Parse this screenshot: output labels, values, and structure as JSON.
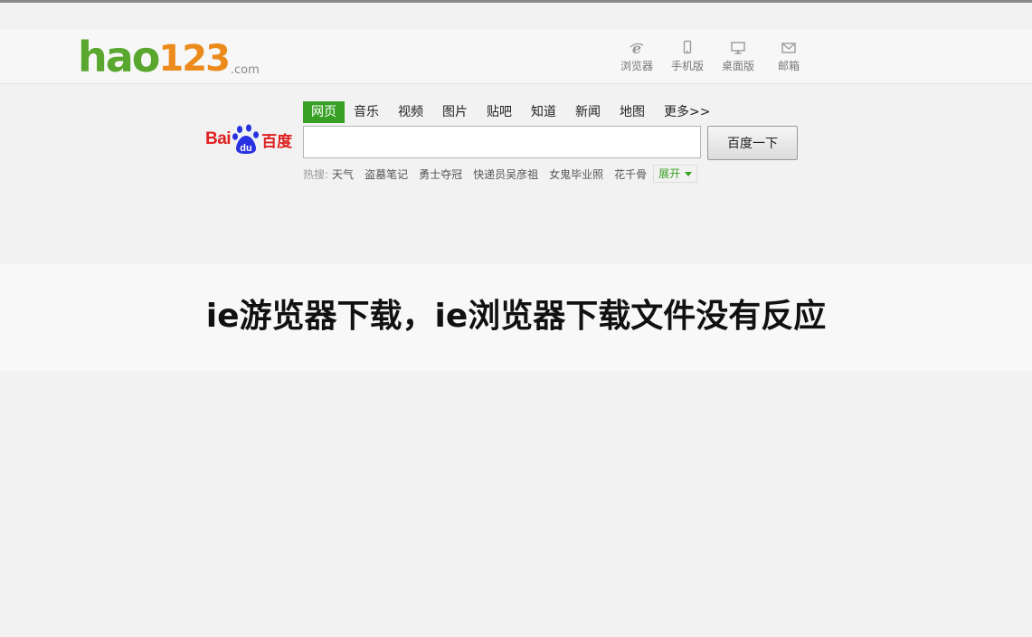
{
  "header": {
    "logo": {
      "main": "hao",
      "num": "123",
      "suffix": ".com"
    },
    "tools": [
      {
        "label": "浏览器",
        "icon": "ie-icon"
      },
      {
        "label": "手机版",
        "icon": "phone-icon"
      },
      {
        "label": "桌面版",
        "icon": "desktop-icon"
      },
      {
        "label": "邮箱",
        "icon": "mail-icon"
      }
    ]
  },
  "search": {
    "logo": {
      "bai": "Bai",
      "paw": "du",
      "cn": "百度"
    },
    "tabs": [
      "网页",
      "音乐",
      "视频",
      "图片",
      "贴吧",
      "知道",
      "新闻",
      "地图",
      "更多>>"
    ],
    "active_tab": "网页",
    "input_value": "",
    "button_label": "百度一下",
    "hot_label": "热搜:",
    "hot_items": [
      "天气",
      "盗墓笔记",
      "勇士夺冠",
      "快递员吴彦祖",
      "女鬼毕业照",
      "花千骨"
    ],
    "expand_label": "展开"
  },
  "article": {
    "title": "ie游览器下载，ie浏览器下载文件没有反应"
  },
  "colors": {
    "green": "#38a025",
    "orange": "#ec8a1b",
    "baidu_red": "#e02020",
    "baidu_blue": "#2932e1"
  }
}
